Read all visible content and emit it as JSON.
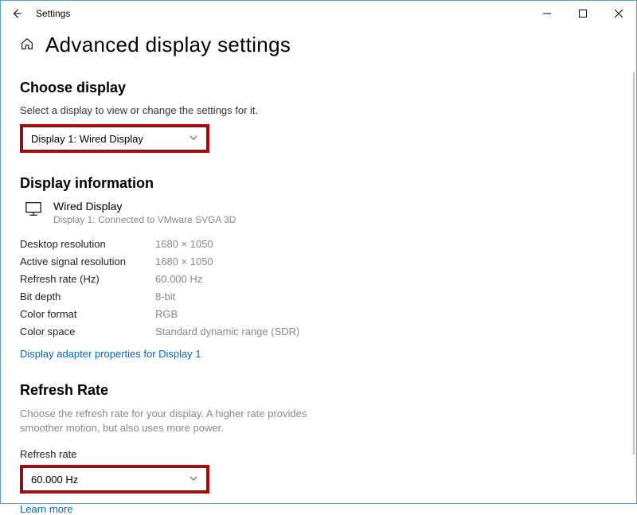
{
  "app_title": "Settings",
  "page_title": "Advanced display settings",
  "choose_display": {
    "heading": "Choose display",
    "caption": "Select a display to view or change the settings for it.",
    "selected": "Display 1: Wired Display"
  },
  "display_info": {
    "heading": "Display information",
    "monitor_name": "Wired Display",
    "monitor_sub": "Display 1: Connected to VMware SVGA 3D",
    "rows": [
      {
        "label": "Desktop resolution",
        "value": "1680 × 1050"
      },
      {
        "label": "Active signal resolution",
        "value": "1680 × 1050"
      },
      {
        "label": "Refresh rate (Hz)",
        "value": "60.000 Hz"
      },
      {
        "label": "Bit depth",
        "value": "8-bit"
      },
      {
        "label": "Color format",
        "value": "RGB"
      },
      {
        "label": "Color space",
        "value": "Standard dynamic range (SDR)"
      }
    ],
    "adapter_link": "Display adapter properties for Display 1"
  },
  "refresh_rate": {
    "heading": "Refresh Rate",
    "desc": "Choose the refresh rate for your display. A higher rate provides smoother motion, but also uses more power.",
    "field_label": "Refresh rate",
    "selected": "60.000 Hz",
    "learn_more": "Learn more"
  }
}
